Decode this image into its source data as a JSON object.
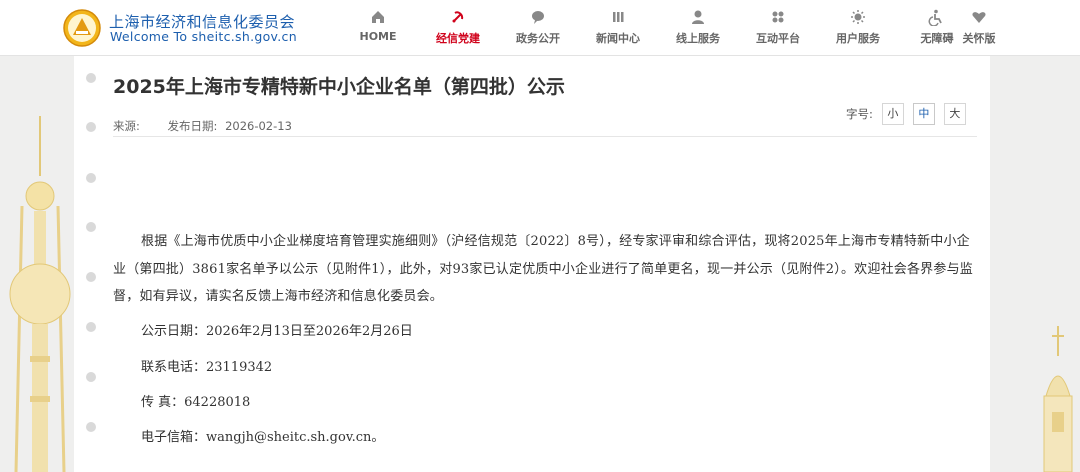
{
  "header": {
    "site_name_cn": "上海市经济和信息化委员会",
    "site_name_en": "Welcome To sheitc.sh.gov.cn",
    "nav": [
      {
        "label": "HOME",
        "icon": "home-icon"
      },
      {
        "label": "经信党建",
        "icon": "party-emblem-icon",
        "active": true
      },
      {
        "label": "政务公开",
        "icon": "chat-bubble-icon"
      },
      {
        "label": "新闻中心",
        "icon": "news-bars-icon"
      },
      {
        "label": "线上服务",
        "icon": "user-service-icon"
      },
      {
        "label": "互动平台",
        "icon": "interaction-grid-icon"
      },
      {
        "label": "用户服务",
        "icon": "sun-service-icon"
      },
      {
        "label": "无障碍",
        "icon": "accessibility-icon"
      },
      {
        "label": "关怀版",
        "icon": "care-heart-icon"
      }
    ]
  },
  "article": {
    "title": "2025年上海市专精特新中小企业名单（第四批）公示",
    "source_label": "来源:",
    "date_label": "发布日期:",
    "date": "2026-02-13",
    "font_size_label": "字号:",
    "font_sizes": [
      "小",
      "中",
      "大"
    ],
    "active_font_size": "中",
    "paragraph": "根据《上海市优质中小企业梯度培育管理实施细则》（沪经信规范〔2022〕8号），经专家评审和综合评估，现将2025年上海市专精特新中小企业（第四批）3861家名单予以公示（见附件1），此外，对93家已认定优质中小企业进行了简单更名，现一并公示（见附件2）。欢迎社会各界参与监督，如有异议，请实名反馈上海市经济和信息化委员会。",
    "publicity_period": "公示日期：2026年2月13日至2026年2月26日",
    "phone": "联系电话：23119342",
    "fax": "传 真：64228018",
    "email": "电子信箱：wangjh@sheitc.sh.gov.cn。"
  },
  "colors": {
    "brand_blue": "#1d5fae",
    "active_red": "#d0021b",
    "page_bg": "#efefee"
  }
}
